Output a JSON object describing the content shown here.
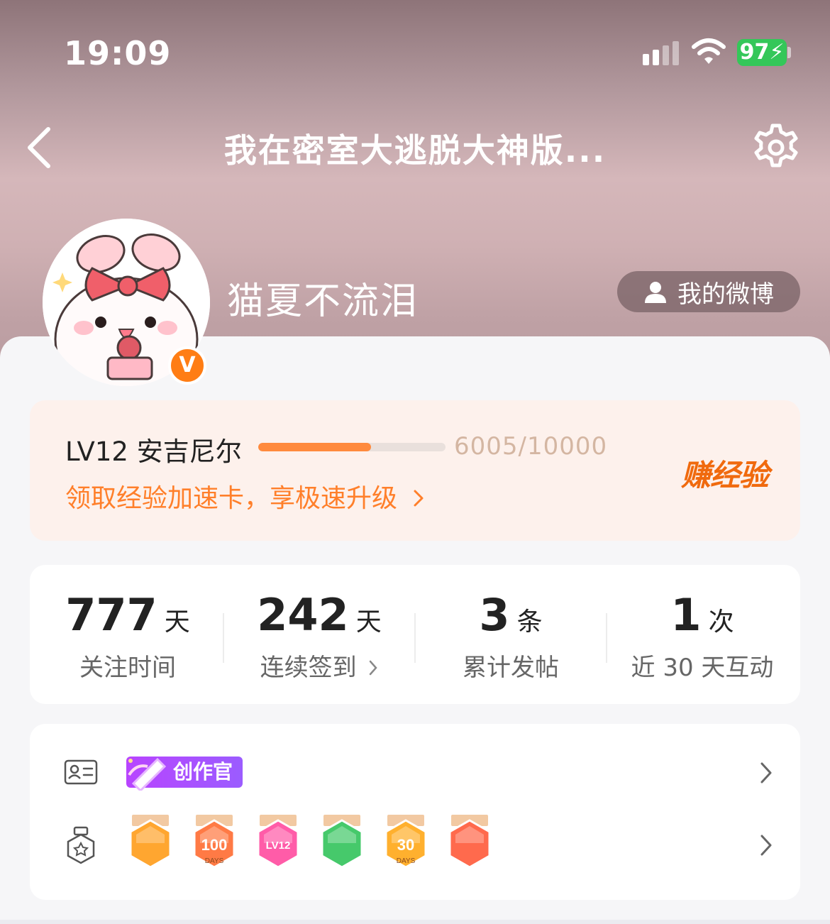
{
  "status_bar": {
    "time": "19:09",
    "battery": "97",
    "icons": [
      "cellular-signal-icon",
      "wifi-icon",
      "battery-charging-icon"
    ]
  },
  "nav": {
    "title": "我在密室大逃脱大神版...",
    "back_icon": "chevron-left-icon",
    "settings_icon": "gear-icon"
  },
  "profile": {
    "username": "猫夏不流泪",
    "verified_badge": "V",
    "my_weibo_label": "我的微博"
  },
  "level": {
    "label": "LV12 安吉尼尔",
    "progress_text": "6005/10000",
    "progress_fraction": 0.6005,
    "boost_link": "领取经验加速卡，享极速升级",
    "earn_button": "赚经验"
  },
  "stats": [
    {
      "value": "777",
      "unit": "天",
      "label": "关注时间"
    },
    {
      "value": "242",
      "unit": "天",
      "label": "连续签到"
    },
    {
      "value": "3",
      "unit": "条",
      "label": "累计发帖"
    },
    {
      "value": "1",
      "unit": "次",
      "label": "近 30 天互动"
    }
  ],
  "badges": {
    "creator_label": "创作官",
    "medals": [
      {
        "name": "crown-medal",
        "color": "#ffa630",
        "text": ""
      },
      {
        "name": "100-days-medal",
        "color": "#ff7a45",
        "text": "100",
        "sub": "DAYS"
      },
      {
        "name": "lv12-medal",
        "color": "#ff5ca8",
        "text": "LV12"
      },
      {
        "name": "hand-medal",
        "color": "#46c96b",
        "text": ""
      },
      {
        "name": "30-days-medal",
        "color": "#ffb02e",
        "text": "30",
        "sub": "DAYS"
      },
      {
        "name": "rock-hand-medal",
        "color": "#ff6a4d",
        "text": ""
      }
    ]
  },
  "colors": {
    "accent": "#ff7f2a",
    "progress": "#ff8a3d",
    "creator": "#b844ff",
    "battery": "#34c759"
  }
}
